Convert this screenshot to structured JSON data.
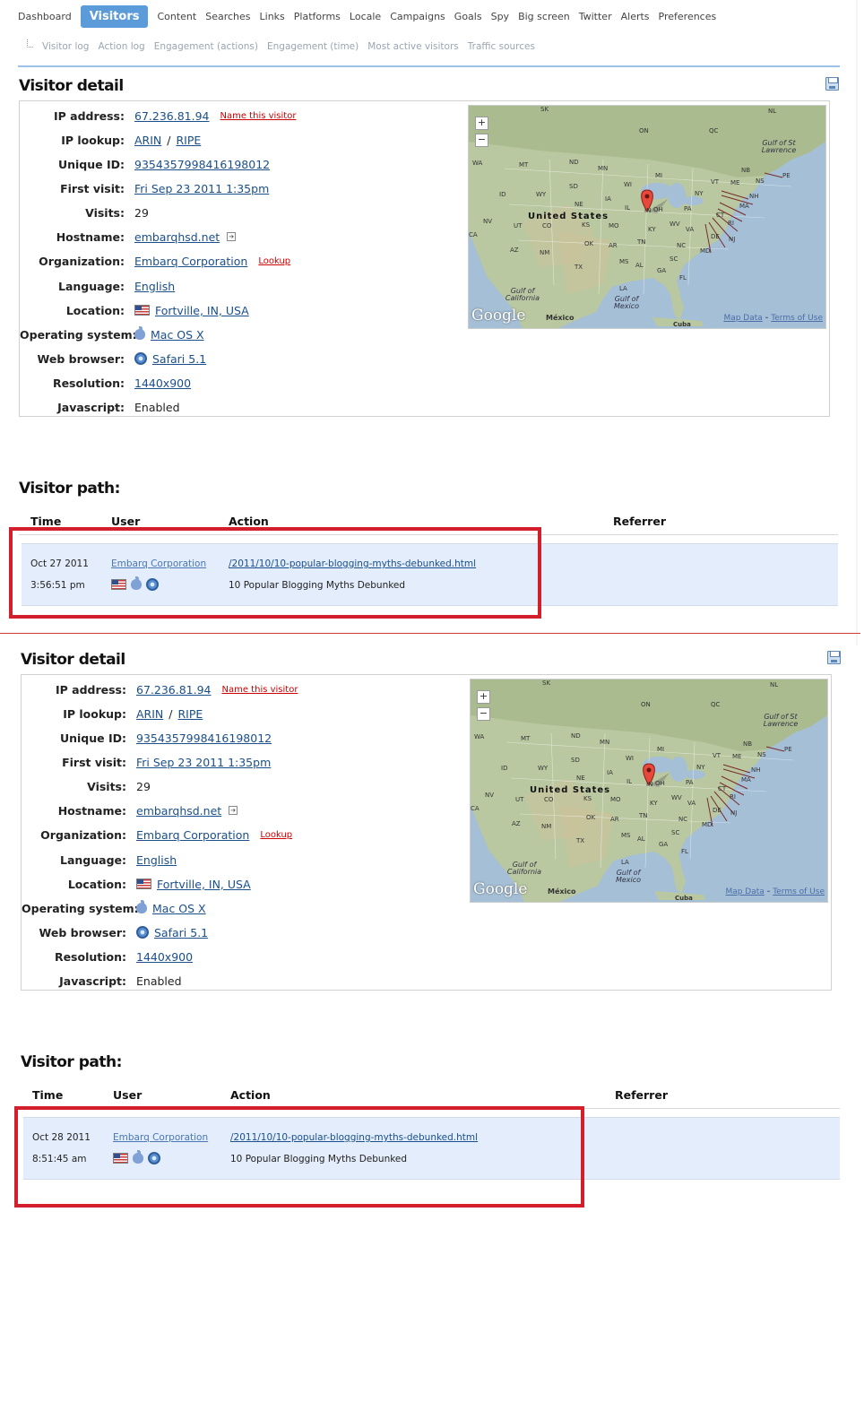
{
  "nav": {
    "items": [
      "Dashboard",
      "Visitors",
      "Content",
      "Searches",
      "Links",
      "Platforms",
      "Locale",
      "Campaigns",
      "Goals",
      "Spy",
      "Big screen",
      "Twitter",
      "Alerts",
      "Preferences"
    ],
    "active": "Visitors"
  },
  "subnav": [
    "Visitor log",
    "Action log",
    "Engagement (actions)",
    "Engagement (time)",
    "Most active visitors",
    "Traffic sources"
  ],
  "detail": {
    "title": "Visitor detail",
    "ip_label": "IP address:",
    "ip": "67.236.81.94",
    "name_link": "Name this visitor",
    "lookup_label": "IP lookup:",
    "arin": "ARIN",
    "sep": "/",
    "ripe": "RIPE",
    "uid_label": "Unique ID:",
    "uid": "9354357998416198012",
    "first_label": "First visit:",
    "first": "Fri Sep 23 2011 1:35pm",
    "visits_label": "Visits:",
    "visits": "29",
    "host_label": "Hostname:",
    "host": "embarqhsd.net",
    "org_label": "Organization:",
    "org": "Embarq Corporation",
    "org_lookup": "Lookup",
    "lang_label": "Language:",
    "lang": "English",
    "loc_label": "Location:",
    "loc": "Fortville, IN, USA",
    "os_label": "Operating system:",
    "os": "Mac OS X",
    "browser_label": "Web browser:",
    "browser": "Safari 5.1",
    "res_label": "Resolution:",
    "res": "1440x900",
    "js_label": "Javascript:",
    "js": "Enabled"
  },
  "map": {
    "labels": {
      "us": "United States",
      "mexico": "México",
      "cuba": "Cuba",
      "gulf_ca": "Gulf of California",
      "gulf_mx": "Gulf of Mexico",
      "gulf_stl": "Gulf of St Lawrence",
      "google": "Google",
      "map_data": "Map Data",
      "dash": "-",
      "terms": "Terms of Use",
      "zoom_in": "+",
      "zoom_out": "−"
    },
    "states": [
      "SK",
      "ON",
      "QC",
      "NL",
      "MT",
      "ND",
      "MN",
      "WI",
      "MI",
      "NB",
      "NS",
      "PE",
      "ME",
      "VT",
      "NH",
      "MA",
      "CT",
      "RI",
      "NY",
      "PA",
      "NJ",
      "DE",
      "MD",
      "VA",
      "WV",
      "OH",
      "IN",
      "IL",
      "IA",
      "NE",
      "SD",
      "WY",
      "ID",
      "WA",
      "NV",
      "CA",
      "UT",
      "CO",
      "KS",
      "MO",
      "KY",
      "TN",
      "NC",
      "SC",
      "GA",
      "AL",
      "MS",
      "AR",
      "LA",
      "TX",
      "OK",
      "NM",
      "AZ",
      "FL"
    ]
  },
  "path": {
    "title": "Visitor path:",
    "col_time": "Time",
    "col_user": "User",
    "col_action": "Action",
    "col_ref": "Referrer",
    "rows": [
      {
        "date": "Oct 27 2011",
        "time": "3:56:51 pm",
        "org": "Embarq Corporation",
        "url": "/2011/10/10-popular-blogging-myths-debunked.html",
        "page_title": "10 Popular Blogging Myths Debunked"
      },
      {
        "date": "Oct 28 2011",
        "time": "8:51:45 am",
        "org": "Embarq Corporation",
        "url": "/2011/10/10-popular-blogging-myths-debunked.html",
        "page_title": "10 Popular Blogging Myths Debunked"
      }
    ]
  },
  "colors": {
    "accent": "#5c9bd9",
    "highlight": "#d21f2b",
    "row_bg": "#e4edfb",
    "link": "#1a4f8b"
  }
}
